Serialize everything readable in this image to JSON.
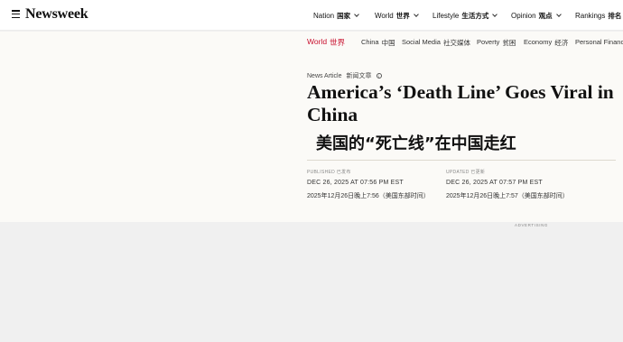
{
  "header": {
    "logo": "Newsweek",
    "nav": [
      {
        "en": "Nation",
        "zh": "国家",
        "has_dropdown": true
      },
      {
        "en": "World",
        "zh": "世界",
        "has_dropdown": true
      },
      {
        "en": "Lifestyle",
        "zh": "生活方式",
        "has_dropdown": true
      },
      {
        "en": "Opinion",
        "zh": "观点",
        "has_dropdown": true
      },
      {
        "en": "Rankings",
        "zh": "排名",
        "has_dropdown": true
      }
    ]
  },
  "subnav": {
    "active": {
      "en": "World",
      "zh": "世界"
    },
    "items": [
      {
        "en": "China",
        "zh": "中国"
      },
      {
        "en": "Social Media",
        "zh": "社交媒体"
      },
      {
        "en": "Poverty",
        "zh": "贫困"
      },
      {
        "en": "Economy",
        "zh": "经济"
      },
      {
        "en": "Personal Financ",
        "zh": ""
      }
    ]
  },
  "article": {
    "type_en": "News Article",
    "type_zh": "新闻文章",
    "headline": "America’s ‘Death Line’ Goes Viral in China",
    "headline_zh": "美国的“死亡线”在中国走红",
    "published_label": "PUBLISHED 已发布",
    "published_date": "DEC 26, 2025 AT 07:56 PM EST",
    "published_zh": "2025年12月26日晚上7:56（美国东部时间）",
    "updated_label": "UPDATED 已更新",
    "updated_date": "DEC 26, 2025 AT 07:57 PM EST",
    "updated_zh": "2025年12月26日晚上7:57（美国东部时间）"
  },
  "ad": {
    "label": "ADVERTISING"
  },
  "colors": {
    "accent": "#c8102e",
    "background": "#fbfaf7"
  }
}
